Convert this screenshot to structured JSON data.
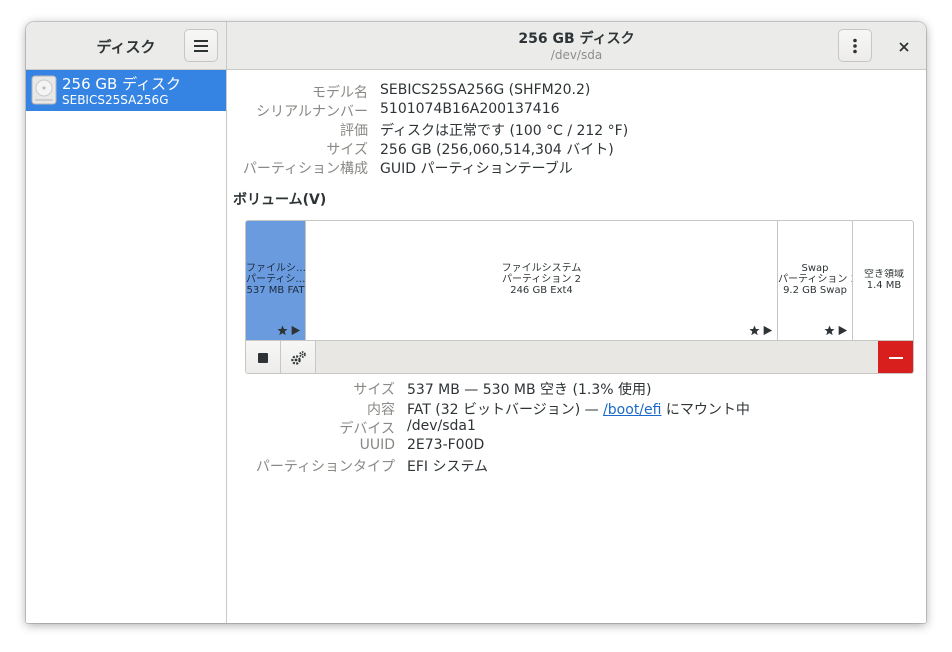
{
  "sidebar": {
    "title": "ディスク",
    "drives": [
      {
        "name": "256 GB ディスク",
        "model": "SEBICS25SA256G"
      }
    ]
  },
  "header": {
    "title": "256 GB ディスク",
    "subtitle": "/dev/sda"
  },
  "disk_info": [
    {
      "label": "モデル名",
      "value": "SEBICS25SA256G (SHFM20.2)"
    },
    {
      "label": "シリアルナンバー",
      "value": "5101074B16A200137416"
    },
    {
      "label": "評価",
      "value": "ディスクは正常です (100 °C / 212 °F)"
    },
    {
      "label": "サイズ",
      "value": "256 GB (256,060,514,304 バイト)"
    },
    {
      "label": "パーティション構成",
      "value": "GUID パーティションテーブル"
    }
  ],
  "volumes_heading": "ボリューム(V)",
  "volumes": [
    {
      "line1": "ファイルシ…",
      "line2": "パーティシ…",
      "line3": "537 MB FAT",
      "selected": true
    },
    {
      "line1": "ファイルシステム",
      "line2": "パーティション 2",
      "line3": "246 GB Ext4",
      "selected": false
    },
    {
      "line1": "Swap",
      "line2": "パーティション 3",
      "line3": "9.2 GB Swap",
      "selected": false
    },
    {
      "line1": "空き領域",
      "line2": "1.4 MB",
      "line3": "",
      "selected": false
    }
  ],
  "partition_info": {
    "size_label": "サイズ",
    "size_value": "537 MB — 530 MB 空き (1.3% 使用)",
    "content_label": "内容",
    "content_prefix": "FAT (32 ビットバージョン) — ",
    "content_link": "/boot/efi",
    "content_suffix": " にマウント中",
    "device_label": "デバイス",
    "device_value": "/dev/sda1",
    "uuid_label": "UUID",
    "uuid_value": "2E73-F00D",
    "type_label": "パーティションタイプ",
    "type_value": "EFI システム"
  },
  "colors": {
    "accent": "#3584e4",
    "selected_segment": "#6a9bde",
    "destructive": "#d91e1e",
    "link": "#1b6acb"
  }
}
